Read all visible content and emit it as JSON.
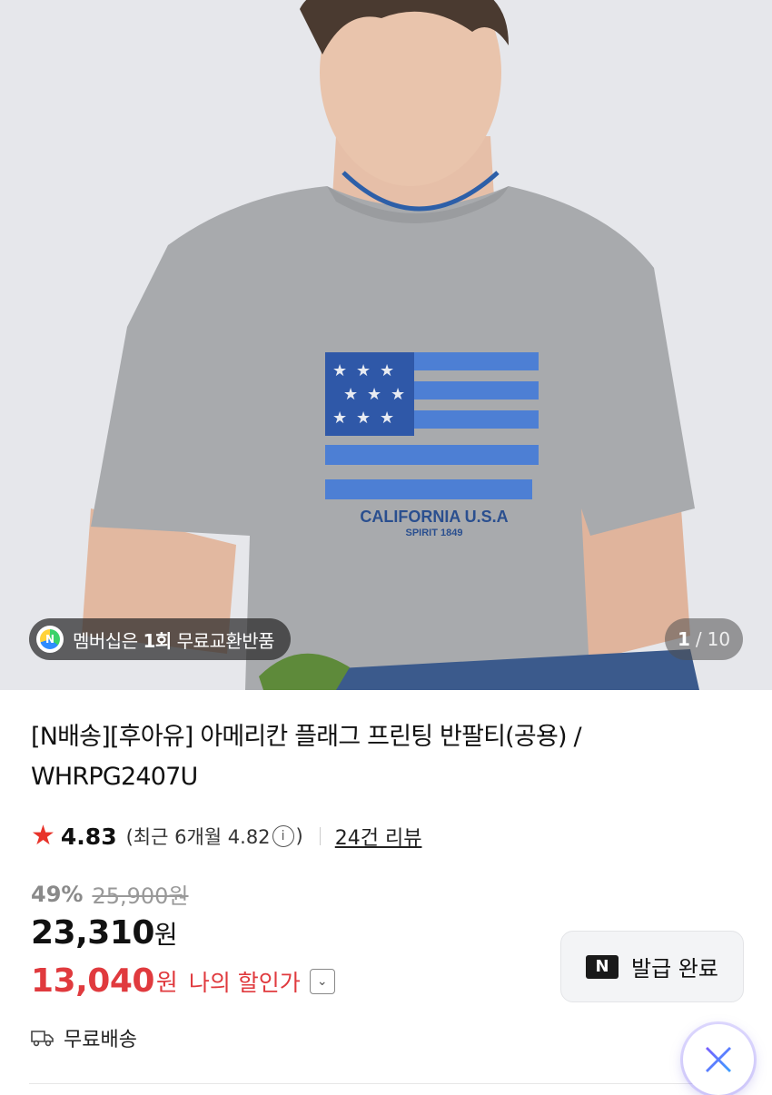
{
  "hero": {
    "membership_badge": {
      "icon": "naver-membership-icon",
      "prefix": "멤버십은 ",
      "highlight": "1회",
      "suffix": " 무료교환반품"
    },
    "pager": {
      "current": "1",
      "separator": "/",
      "total": "10"
    },
    "shirt_print": {
      "line1": "CALIFORNIA U.S.A",
      "line2": "SPIRIT 1849"
    }
  },
  "product": {
    "title": "[N배송][후아유] 아메리칸 플래그 프린팅 반팔티(공용) / WHRPG2407U",
    "rating": {
      "score": "4.83",
      "recent": "(최근 6개월 4.82",
      "recent_close": ")",
      "info_glyph": "i",
      "reviews_label": "24건 리뷰"
    },
    "price": {
      "discount_pct": "49%",
      "original": "25,900원",
      "sale_amount": "23,310",
      "sale_unit": "원",
      "my_amount": "13,040",
      "my_unit": "원",
      "my_label": "나의 할인가",
      "chevron": "⌄"
    },
    "coupon_button": {
      "icon_text": "N",
      "label": "발급 완료"
    },
    "shipping": {
      "icon": "truck-icon",
      "label": "무료배송"
    }
  },
  "colors": {
    "accent_red": "#e03a3e",
    "star": "#e8332a",
    "badge_bg": "#282828"
  }
}
